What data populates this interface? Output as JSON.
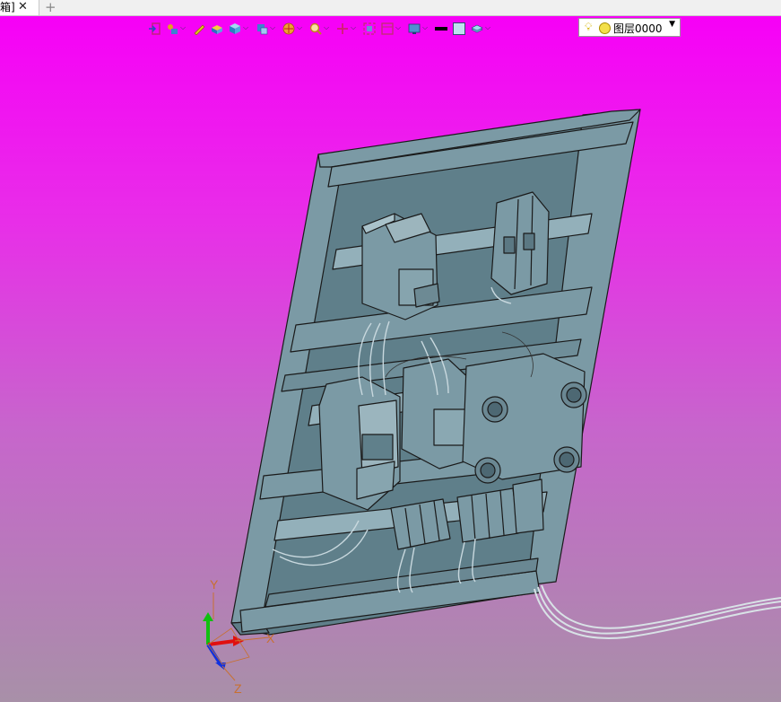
{
  "tabs": [
    {
      "label": "箱]",
      "close_icon": "close-icon"
    }
  ],
  "new_tab_icon": "plus-icon",
  "toolbar": {
    "tools": [
      {
        "icon": "import-icon",
        "dropdown": false
      },
      {
        "icon": "view-orient-icon",
        "dropdown": true
      },
      {
        "icon": "pen-icon",
        "dropdown": false
      },
      {
        "icon": "shaded-box-icon",
        "dropdown": false
      },
      {
        "icon": "cube-icon",
        "dropdown": true
      },
      {
        "icon": "section-view-icon",
        "dropdown": true
      },
      {
        "icon": "render-sphere-icon",
        "dropdown": true
      },
      {
        "icon": "zoom-icon",
        "dropdown": true
      },
      {
        "icon": "pan-icon",
        "dropdown": true
      },
      {
        "icon": "fit-view-icon",
        "dropdown": false
      },
      {
        "icon": "save-view-icon",
        "dropdown": true
      },
      {
        "icon": "display-mode-icon",
        "dropdown": true
      },
      {
        "icon": "line-color-icon",
        "dropdown": false
      },
      {
        "icon": "fill-color-icon",
        "dropdown": false
      },
      {
        "icon": "layer-tool-icon",
        "dropdown": true
      }
    ],
    "layer": {
      "label": "图层0000",
      "bulb_icon": "lightbulb-icon"
    }
  },
  "axes": {
    "x": "X",
    "y": "Y",
    "z": "Z"
  },
  "colors": {
    "bg_top": "#f700f7",
    "bg_bottom": "#a890a8",
    "model_body": "#7b9aa5",
    "model_edge": "#1a1a1a",
    "axis_x": "#e01010",
    "axis_y": "#10c010",
    "axis_z": "#1030e0"
  }
}
